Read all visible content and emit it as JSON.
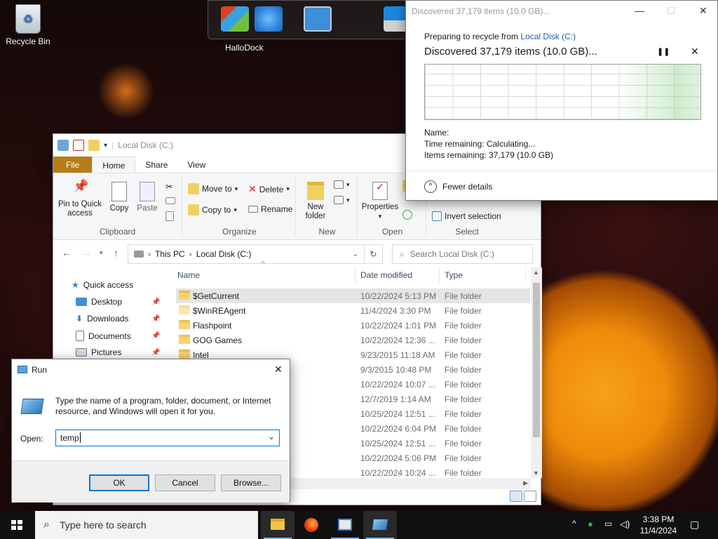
{
  "desktop": {
    "recycle_bin_label": "Recycle Bin"
  },
  "dock": {
    "label": "HalloDock"
  },
  "explorer": {
    "title": "Local Disk (C:)",
    "tabs": [
      "File",
      "Home",
      "Share",
      "View"
    ],
    "clipboard": {
      "pin": "Pin to Quick access",
      "copy": "Copy",
      "paste": "Paste",
      "label": "Clipboard"
    },
    "organize": {
      "move_to": "Move to",
      "copy_to": "Copy to",
      "delete": "Delete",
      "rename": "Rename",
      "label": "Organize"
    },
    "new": {
      "new_folder": "New folder",
      "label": "New"
    },
    "open": {
      "properties": "Properties",
      "label": "Open"
    },
    "select": {
      "invert": "Invert selection",
      "label": "Select"
    },
    "breadcrumb": [
      "This PC",
      "Local Disk (C:)"
    ],
    "search_placeholder": "Search Local Disk (C:)",
    "nav": {
      "quick_access": "Quick access",
      "desktop": "Desktop",
      "downloads": "Downloads",
      "documents": "Documents",
      "pictures": "Pictures"
    },
    "columns": {
      "name": "Name",
      "date": "Date modified",
      "type": "Type"
    },
    "rows": [
      {
        "name": "$GetCurrent",
        "date": "10/22/2024 5:13 PM",
        "type": "File folder"
      },
      {
        "name": "$WinREAgent",
        "date": "11/4/2024 3:30 PM",
        "type": "File folder"
      },
      {
        "name": "Flashpoint",
        "date": "10/22/2024 1:01 PM",
        "type": "File folder"
      },
      {
        "name": "GOG Games",
        "date": "10/22/2024 12:36 ...",
        "type": "File folder"
      },
      {
        "name": "Intel",
        "date": "9/23/2015 11:18 AM",
        "type": "File folder"
      },
      {
        "name": "",
        "date": "9/3/2015 10:48 PM",
        "type": "File folder"
      },
      {
        "name": "",
        "date": "10/22/2024 10:07 ...",
        "type": "File folder"
      },
      {
        "name": "",
        "date": "12/7/2019 1:14 AM",
        "type": "File folder"
      },
      {
        "name": "",
        "date": "10/25/2024 12:51 ...",
        "type": "File folder"
      },
      {
        "name": "",
        "date": "10/22/2024 6:04 PM",
        "type": "File folder"
      },
      {
        "name": "",
        "date": "10/25/2024 12:51 ...",
        "type": "File folder"
      },
      {
        "name": "",
        "date": "10/22/2024 5:06 PM",
        "type": "File folder"
      },
      {
        "name": "",
        "date": "10/22/2024 10:24 ...",
        "type": "File folder"
      }
    ]
  },
  "progress": {
    "title": "Discovered 37,179 items (10.0 GB)...",
    "preparing_prefix": "Preparing to recycle from",
    "preparing_link": "Local Disk (C:)",
    "headline": "Discovered 37,179 items (10.0 GB)...",
    "name_label": "Name:",
    "time_label": "Time remaining:",
    "time_value": "Calculating...",
    "items_label": "Items remaining:",
    "items_value": "37,179 (10.0 GB)",
    "fewer_details": "Fewer details"
  },
  "run": {
    "title": "Run",
    "description": "Type the name of a program, folder, document, or Internet resource, and Windows will open it for you.",
    "open_label": "Open:",
    "open_value": "temp",
    "ok": "OK",
    "cancel": "Cancel",
    "browse": "Browse..."
  },
  "taskbar": {
    "search_placeholder": "Type here to search",
    "time": "3:38 PM",
    "date": "11/4/2024"
  },
  "colors": {
    "accent": "#0078d7",
    "file_tab": "#b67c18",
    "link": "#1e5fb4"
  }
}
